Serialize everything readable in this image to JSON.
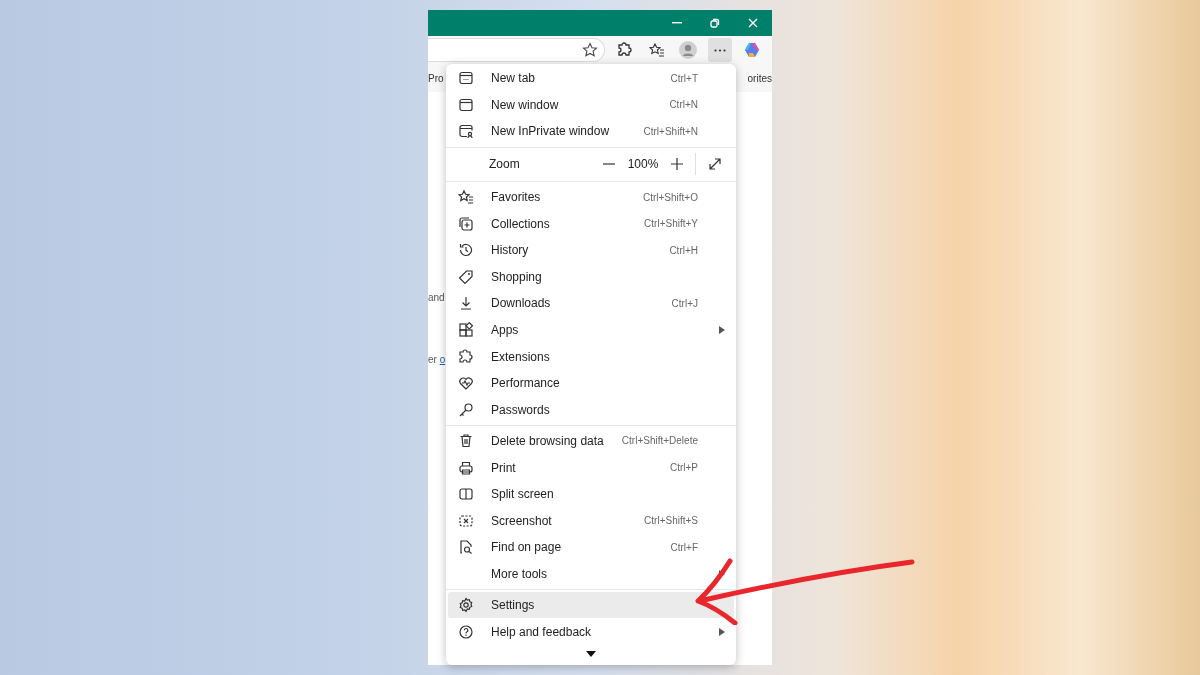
{
  "bookmarks_bar": {
    "items": [
      "Pro",
      "orites"
    ]
  },
  "page": {
    "texts": [
      {
        "kind": "text",
        "text": "and"
      },
      {
        "kind": "link",
        "prefix": "er",
        "text": "o"
      }
    ]
  },
  "menu": {
    "groups": [
      [
        {
          "kind": "command",
          "label": "New tab",
          "shortcut": "Ctrl+T",
          "submenu": false,
          "selected": false
        },
        {
          "kind": "command",
          "label": "New window",
          "shortcut": "Ctrl+N",
          "submenu": false,
          "selected": false
        },
        {
          "kind": "command",
          "label": "New InPrivate window",
          "shortcut": "Ctrl+Shift+N",
          "submenu": false,
          "selected": false
        }
      ],
      [
        {
          "kind": "zoom",
          "label": "Zoom",
          "value": "100%"
        }
      ],
      [
        {
          "kind": "command",
          "label": "Favorites",
          "shortcut": "Ctrl+Shift+O",
          "submenu": false,
          "selected": false
        },
        {
          "kind": "command",
          "label": "Collections",
          "shortcut": "Ctrl+Shift+Y",
          "submenu": false,
          "selected": false
        },
        {
          "kind": "command",
          "label": "History",
          "shortcut": "Ctrl+H",
          "submenu": false,
          "selected": false
        },
        {
          "kind": "command",
          "label": "Shopping",
          "submenu": false,
          "selected": false
        },
        {
          "kind": "command",
          "label": "Downloads",
          "shortcut": "Ctrl+J",
          "submenu": false,
          "selected": false
        },
        {
          "kind": "command",
          "label": "Apps",
          "submenu": true,
          "selected": false
        },
        {
          "kind": "command",
          "label": "Extensions",
          "submenu": false,
          "selected": false
        },
        {
          "kind": "command",
          "label": "Performance",
          "submenu": false,
          "selected": false
        },
        {
          "kind": "command",
          "label": "Passwords",
          "submenu": false,
          "selected": false
        }
      ],
      [
        {
          "kind": "command",
          "label": "Delete browsing data",
          "shortcut": "Ctrl+Shift+Delete",
          "submenu": false,
          "selected": false
        },
        {
          "kind": "command",
          "label": "Print",
          "shortcut": "Ctrl+P",
          "submenu": false,
          "selected": false
        },
        {
          "kind": "command",
          "label": "Split screen",
          "submenu": false,
          "selected": false
        },
        {
          "kind": "command",
          "label": "Screenshot",
          "shortcut": "Ctrl+Shift+S",
          "submenu": false,
          "selected": false
        },
        {
          "kind": "command",
          "label": "Find on page",
          "shortcut": "Ctrl+F",
          "submenu": false,
          "selected": false
        },
        {
          "kind": "command",
          "label": "More tools",
          "submenu": true,
          "selected": false
        }
      ],
      [
        {
          "kind": "command",
          "label": "Settings",
          "submenu": false,
          "selected": true
        },
        {
          "kind": "command",
          "label": "Help and feedback",
          "submenu": true,
          "selected": false
        }
      ]
    ]
  }
}
